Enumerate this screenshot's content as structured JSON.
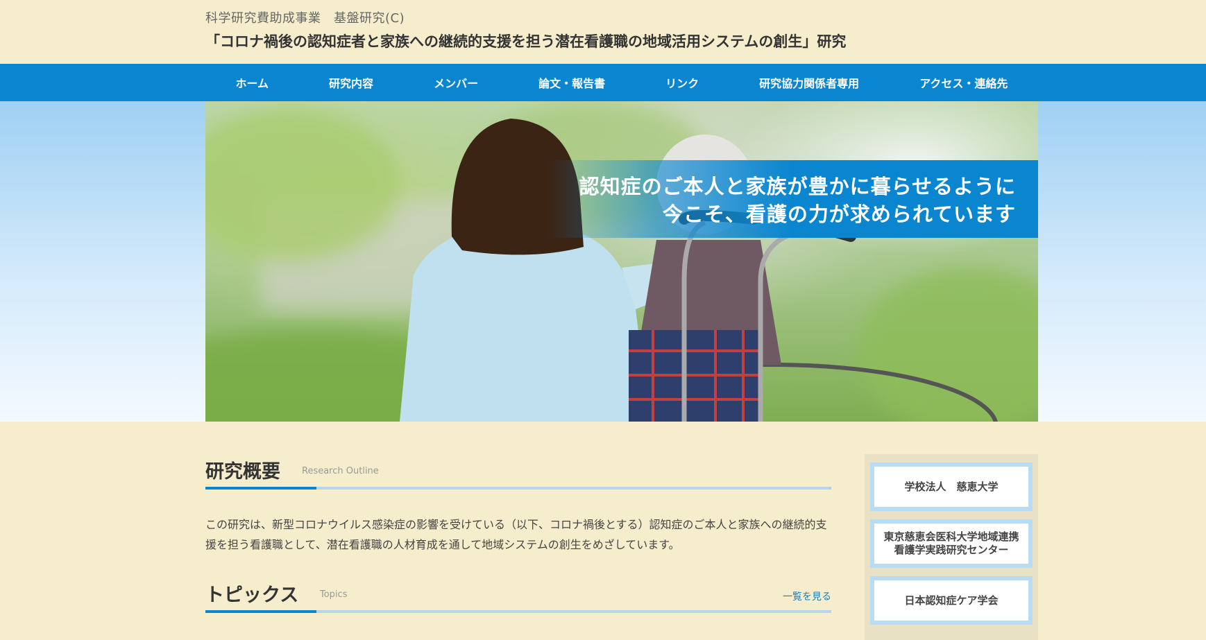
{
  "header": {
    "subtitle": "科学研究費助成事業　基盤研究(C)",
    "title": "「コロナ禍後の認知症者と家族への継続的支援を担う潜在看護職の地域活用システムの創生」研究"
  },
  "nav": {
    "items": [
      {
        "label": "ホーム"
      },
      {
        "label": "研究内容"
      },
      {
        "label": "メンバー"
      },
      {
        "label": "論文・報告書"
      },
      {
        "label": "リンク"
      },
      {
        "label": "研究協力関係者専用"
      },
      {
        "label": "アクセス・連絡先"
      }
    ]
  },
  "hero": {
    "caption_line1": "認知症のご本人と家族が豊かに暮らせるように",
    "caption_line2": "今こそ、看護の力が求められています"
  },
  "outline": {
    "title": "研究概要",
    "title_en": "Research Outline",
    "text": "この研究は、新型コロナウイルス感染症の影響を受けている（以下、コロナ禍後とする）認知症のご本人と家族への継続的支援を担う看護職として、潜在看護職の人材育成を通して地域システムの創生をめざしています。"
  },
  "topics": {
    "title": "トピックス",
    "title_en": "Topics",
    "see_all": "一覧を見る"
  },
  "sidebar": {
    "buttons": [
      {
        "lines": [
          "学校法人　慈恵大学"
        ]
      },
      {
        "lines": [
          "東京慈恵会医科大学地域連携",
          "看護学実践研究センター"
        ]
      },
      {
        "lines": [
          "日本認知症ケア学会"
        ]
      }
    ]
  },
  "colors": {
    "nav_blue": "#0a86d1",
    "page_bg": "#f5edcc",
    "accent_light_blue": "#b4d6ed"
  }
}
